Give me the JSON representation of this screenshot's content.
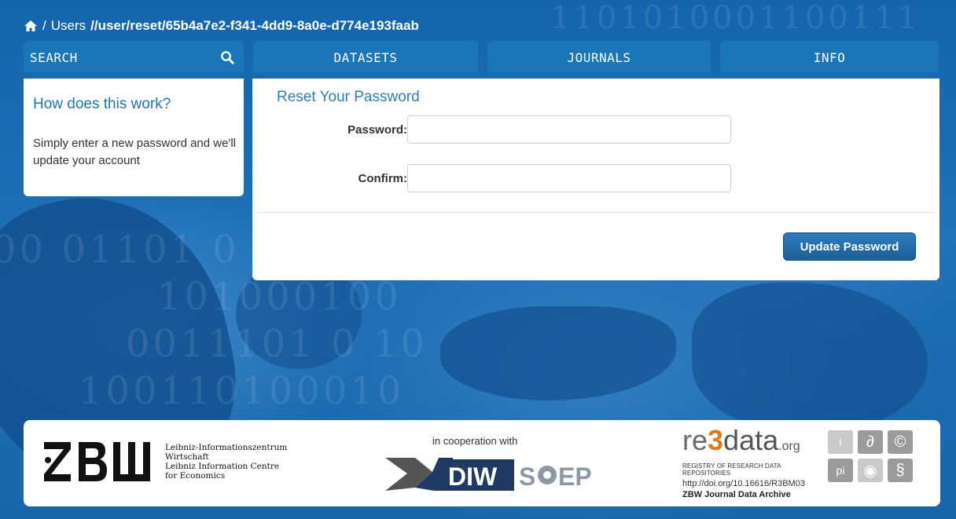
{
  "breadcrumb": {
    "home_icon": "home-icon",
    "separator": "/",
    "users": "Users",
    "path": "//user/reset/65b4a7e2-f341-4dd9-8a0e-d774e193faab"
  },
  "nav": {
    "search": "SEARCH",
    "search_icon": "search-icon",
    "datasets": "DATASETS",
    "journals": "JOURNALS",
    "info": "INFO"
  },
  "help": {
    "title": "How does this work?",
    "body": "Simply enter a new password and we'll update your account"
  },
  "reset": {
    "title": "Reset Your Password",
    "password_label": "Password:",
    "password_value": "",
    "confirm_label": "Confirm:",
    "confirm_value": "",
    "update_button": "Update Password"
  },
  "footer": {
    "zbw_line1": "Leibniz-Informationszentrum",
    "zbw_line2": "Wirtschaft",
    "zbw_line3": "Leibniz Information Centre",
    "zbw_line4": "for Economics",
    "cooperation": "in cooperation with",
    "re3_registry": "REGISTRY OF RESEARCH DATA REPOSITORIES",
    "re3_doi": "http://doi.org/10.16616/R3BM03",
    "re3_name": "ZBW Journal Data Archive",
    "badges": [
      "i",
      "∂",
      "©",
      "pi",
      "◉",
      "§"
    ]
  },
  "colors": {
    "accent": "#1d77b7",
    "nav_bg": "#1976b8",
    "button": "#1c5e98",
    "re3_orange": "#e07b1a"
  }
}
